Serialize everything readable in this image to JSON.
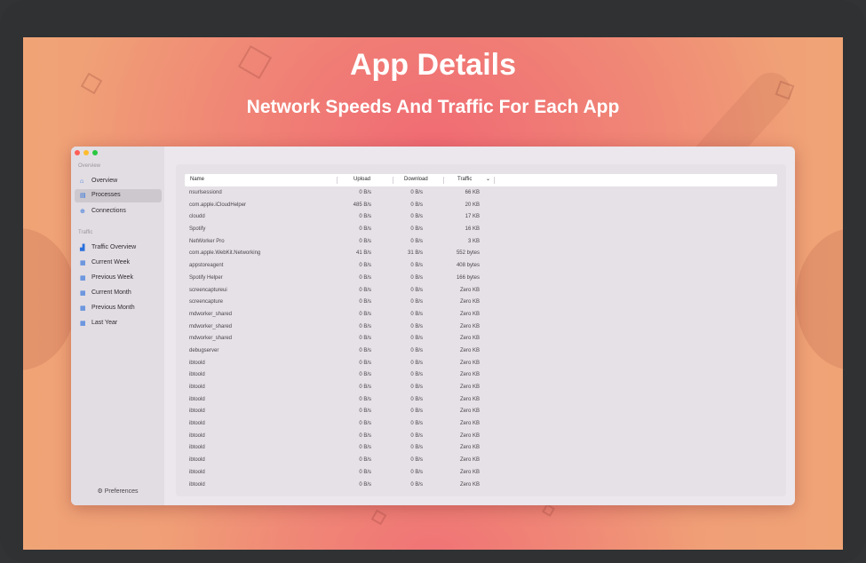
{
  "banner": {
    "title": "App Details",
    "subtitle": "Network Speeds And Traffic For Each App"
  },
  "sidebar": {
    "section_overview": "Overview",
    "section_traffic": "Traffic",
    "items": [
      {
        "label": "Overview",
        "icon": "house-icon"
      },
      {
        "label": "Processes",
        "icon": "list-icon",
        "active": true
      },
      {
        "label": "Connections",
        "icon": "globe-icon"
      },
      {
        "label": "Traffic Overview",
        "icon": "bar-chart-icon"
      },
      {
        "label": "Current Week",
        "icon": "calendar-icon"
      },
      {
        "label": "Previous Week",
        "icon": "calendar-icon"
      },
      {
        "label": "Current Month",
        "icon": "calendar-icon"
      },
      {
        "label": "Previous Month",
        "icon": "calendar-icon"
      },
      {
        "label": "Last Year",
        "icon": "calendar-icon"
      }
    ],
    "preferences": "⚙ Preferences"
  },
  "table": {
    "columns": [
      "Name",
      "Upload",
      "Download",
      "Traffic"
    ],
    "sort_indicator": "⌄",
    "rows": [
      [
        "nsurlsessiond",
        "0 B/s",
        "0 B/s",
        "66 KB"
      ],
      [
        "com.apple.iCloudHelper",
        "485 B/s",
        "0 B/s",
        "20 KB"
      ],
      [
        "cloudd",
        "0 B/s",
        "0 B/s",
        "17 KB"
      ],
      [
        "Spotify",
        "0 B/s",
        "0 B/s",
        "16 KB"
      ],
      [
        "NetWorker Pro",
        "0 B/s",
        "0 B/s",
        "3 KB"
      ],
      [
        "com.apple.WebKit.Networking",
        "41 B/s",
        "31 B/s",
        "552 bytes"
      ],
      [
        "appstoreagent",
        "0 B/s",
        "0 B/s",
        "408 bytes"
      ],
      [
        "Spotify Helper",
        "0 B/s",
        "0 B/s",
        "166 bytes"
      ],
      [
        "screencaptureui",
        "0 B/s",
        "0 B/s",
        "Zero KB"
      ],
      [
        "screencapture",
        "0 B/s",
        "0 B/s",
        "Zero KB"
      ],
      [
        "mdworker_shared",
        "0 B/s",
        "0 B/s",
        "Zero KB"
      ],
      [
        "mdworker_shared",
        "0 B/s",
        "0 B/s",
        "Zero KB"
      ],
      [
        "mdworker_shared",
        "0 B/s",
        "0 B/s",
        "Zero KB"
      ],
      [
        "debugserver",
        "0 B/s",
        "0 B/s",
        "Zero KB"
      ],
      [
        "ibtoold",
        "0 B/s",
        "0 B/s",
        "Zero KB"
      ],
      [
        "ibtoold",
        "0 B/s",
        "0 B/s",
        "Zero KB"
      ],
      [
        "ibtoold",
        "0 B/s",
        "0 B/s",
        "Zero KB"
      ],
      [
        "ibtoold",
        "0 B/s",
        "0 B/s",
        "Zero KB"
      ],
      [
        "ibtoold",
        "0 B/s",
        "0 B/s",
        "Zero KB"
      ],
      [
        "ibtoold",
        "0 B/s",
        "0 B/s",
        "Zero KB"
      ],
      [
        "ibtoold",
        "0 B/s",
        "0 B/s",
        "Zero KB"
      ],
      [
        "ibtoold",
        "0 B/s",
        "0 B/s",
        "Zero KB"
      ],
      [
        "ibtoold",
        "0 B/s",
        "0 B/s",
        "Zero KB"
      ],
      [
        "ibtoold",
        "0 B/s",
        "0 B/s",
        "Zero KB"
      ],
      [
        "ibtoold",
        "0 B/s",
        "0 B/s",
        "Zero KB"
      ]
    ]
  }
}
